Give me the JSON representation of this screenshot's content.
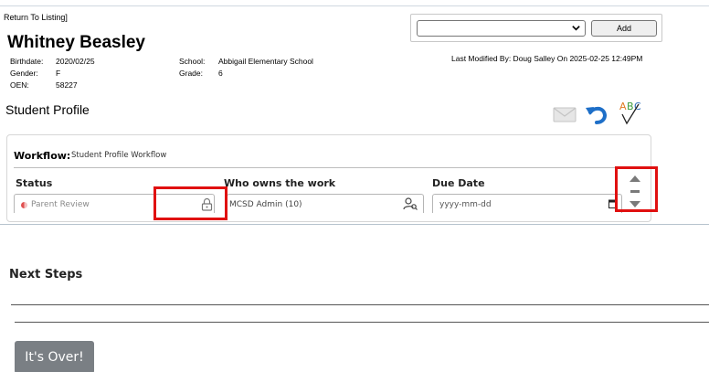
{
  "header": {
    "return_link": "Return To Listing]",
    "student_name": "Whitney Beasley",
    "last_modified": "Last Modified By: Doug Salley On 2025-02-25 12:49PM"
  },
  "student_info": {
    "birthdate_label": "Birthdate:",
    "birthdate": "2020/02/25",
    "gender_label": "Gender:",
    "gender": "F",
    "oen_label": "OEN:",
    "oen": "58227",
    "school_label": "School:",
    "school": "Abbigail Elementary School",
    "grade_label": "Grade:",
    "grade": "6"
  },
  "add_form": {
    "selected": "",
    "add_label": "Add"
  },
  "page_title": "Student Profile",
  "toolbar": {
    "icons": [
      "mail-icon",
      "undo-icon",
      "spellcheck-icon"
    ]
  },
  "workflow": {
    "label": "Workflow:",
    "name": "Student Profile Workflow",
    "status_header": "Status",
    "status_value": "Parent Review",
    "owner_header": "Who owns the work",
    "owner_value": "MCSD Admin (10)",
    "due_header": "Due Date",
    "due_placeholder": "yyyy-mm-dd"
  },
  "next_steps": {
    "title": "Next Steps",
    "button_label": "It's Over!"
  },
  "colors": {
    "highlight": "#e01010",
    "button": "#7a7f84",
    "undo_blue": "#1e6fc8"
  }
}
